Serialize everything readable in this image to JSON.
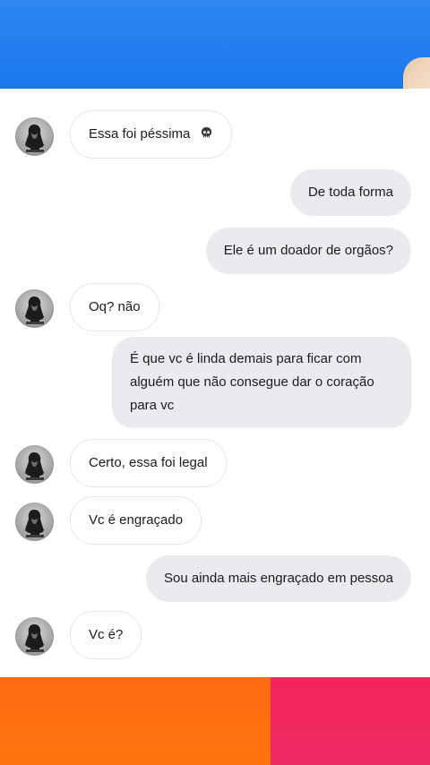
{
  "contact": {
    "avatar_icon": "profile-photo-silhouette"
  },
  "messages": [
    {
      "from": "them",
      "text": "Essa foi péssima",
      "emoji": "skull-emoji"
    },
    {
      "from": "me",
      "text": "De toda forma"
    },
    {
      "from": "me",
      "text": "Ele é um doador de orgãos?"
    },
    {
      "from": "them",
      "text": "Oq? não"
    },
    {
      "from": "me",
      "text": "É que vc é linda demais para ficar com alguém que não consegue dar o coração para vc"
    },
    {
      "from": "them",
      "text": "Certo, essa foi legal"
    },
    {
      "from": "them",
      "text": "Vc é engraçado"
    },
    {
      "from": "me",
      "text": "Sou ainda mais engraçado em pessoa"
    },
    {
      "from": "them",
      "text": "Vc é?"
    }
  ],
  "colors": {
    "top_background": "#1a78ec",
    "bottom_left": "#ff6a12",
    "bottom_right": "#f0245a",
    "outgoing_bubble": "#e9ebee",
    "incoming_bubble": "#ffffff"
  }
}
